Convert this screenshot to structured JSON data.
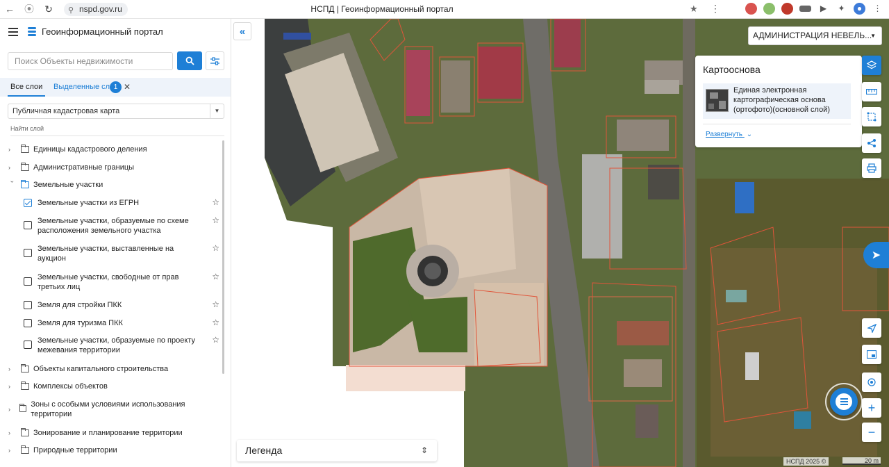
{
  "browser": {
    "url": "nspd.gov.ru",
    "tab_title": "НСПД | Геоинформационный портал"
  },
  "header": {
    "portal_title": "Геоинформационный портал"
  },
  "search": {
    "placeholder": "Поиск Объекты недвижимости"
  },
  "tabs": {
    "all_layers": "Все слои",
    "selected_layers": "Выделенные слои",
    "selected_count": "1"
  },
  "layer_select": {
    "value": "Публичная кадастровая карта"
  },
  "find_layer": "Найти слой",
  "tree": [
    {
      "label": "Единицы кадастрового деления",
      "expanded": false
    },
    {
      "label": "Административные границы",
      "expanded": false
    },
    {
      "label": "Земельные участки",
      "expanded": true
    },
    {
      "label": "Объекты капитального строительства",
      "expanded": false
    },
    {
      "label": "Комплексы объектов",
      "expanded": false
    },
    {
      "label": "Зоны с особыми условиями использования территории",
      "expanded": false
    },
    {
      "label": "Зонирование и планирование территории",
      "expanded": false
    },
    {
      "label": "Природные территории",
      "expanded": false
    }
  ],
  "layers": [
    {
      "label": "Земельные участки из ЕГРН",
      "checked": true
    },
    {
      "label": "Земельные участки, образуемые по схеме расположения земельного участка",
      "checked": false
    },
    {
      "label": "Земельные участки, выставленные на аукцион",
      "checked": false
    },
    {
      "label": "Земельные участки, свободные от прав третьих лиц",
      "checked": false
    },
    {
      "label": "Земля для стройки ПКК",
      "checked": false
    },
    {
      "label": "Земля для туризма ПКК",
      "checked": false
    },
    {
      "label": "Земельные участки, образуемые по проекту межевания территории",
      "checked": false
    }
  ],
  "map": {
    "admin_select": "АДМИНИСТРАЦИЯ НЕВЕЛЬ...",
    "basemap": {
      "title": "Картооснова",
      "layer_name": "Единая электронная картографическая основа (ортофото)(основной слой)",
      "expand_link": "Развернуть"
    },
    "legend": "Легенда",
    "attribution": "НСПД 2025 ©",
    "scale": "20 m"
  },
  "icons": {
    "tools_top": [
      "layers-icon",
      "ruler-icon",
      "select-area-icon",
      "share-icon",
      "print-icon"
    ],
    "tools_bottom": [
      "locate-icon",
      "minimap-icon",
      "geolocation-icon",
      "zoom-in-icon",
      "zoom-out-icon"
    ]
  },
  "colors": {
    "accent": "#1e7fd6",
    "parcel_border": "#e0553a"
  }
}
